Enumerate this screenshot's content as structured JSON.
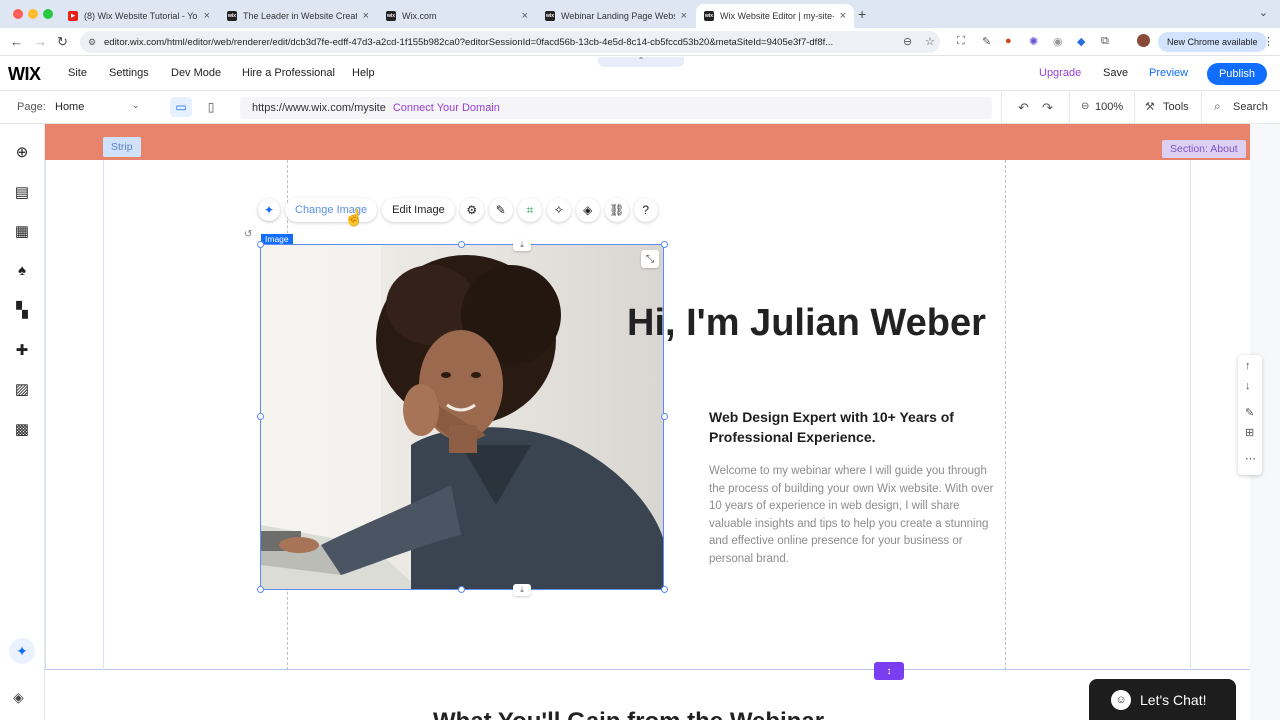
{
  "browser": {
    "tabs": [
      {
        "label": "(8) Wix Website Tutorial - Yo",
        "favicon_color": "#e62117"
      },
      {
        "label": "The Leader in Website Creati",
        "favicon_color": "#222222"
      },
      {
        "label": "Wix.com",
        "favicon_color": "#222222"
      },
      {
        "label": "Webinar Landing Page Websi",
        "favicon_color": "#222222"
      },
      {
        "label": "Wix Website Editor | my-site-",
        "favicon_color": "#222222"
      }
    ],
    "url": "editor.wix.com/html/editor/web/renderer/edit/dcb3d7fe-edff-47d3-a2cd-1f155b982ca0?editorSessionId=0facd56b-13cb-4e5d-8c14-cb5fccd53b20&metaSiteId=9405e3f7-df8f...",
    "new_chrome_label": "New Chrome available"
  },
  "wix": {
    "logo": "WIX",
    "menu": [
      "Site",
      "Settings",
      "Dev Mode",
      "Hire a Professional",
      "Help"
    ],
    "upgrade": "Upgrade",
    "save": "Save",
    "preview": "Preview",
    "publish": "Publish"
  },
  "pagebar": {
    "page_label": "Page:",
    "page_value": "Home",
    "site_url": "https://www.wix.com/mysite",
    "connect_domain": "Connect Your Domain",
    "zoom": "100%",
    "tools": "Tools",
    "search": "Search"
  },
  "canvas": {
    "strip_label": "Strip",
    "section_label": "Section: About",
    "image_tag": "Image",
    "toolbar": {
      "change_image": "Change Image",
      "edit_image": "Edit Image"
    },
    "hero_title": "Hi, I'm Julian Weber",
    "subheading": "Web Design Expert with 10+ Years of Professional Experience.",
    "body": "Welcome to my webinar where I will guide you through the process of building your own Wix website. With over 10 years of experience in web design, I will share valuable insights and tips to help you create a stunning and effective online presence for your business or personal brand.",
    "next_section_title": "What You'll Gain from the Webinar"
  },
  "chat": {
    "label": "Let's Chat!"
  },
  "colors": {
    "wix_blue": "#116dff",
    "strip": "#e8836c",
    "upgrade_purple": "#9a3fd6",
    "anchor_purple": "#7a3df0"
  }
}
